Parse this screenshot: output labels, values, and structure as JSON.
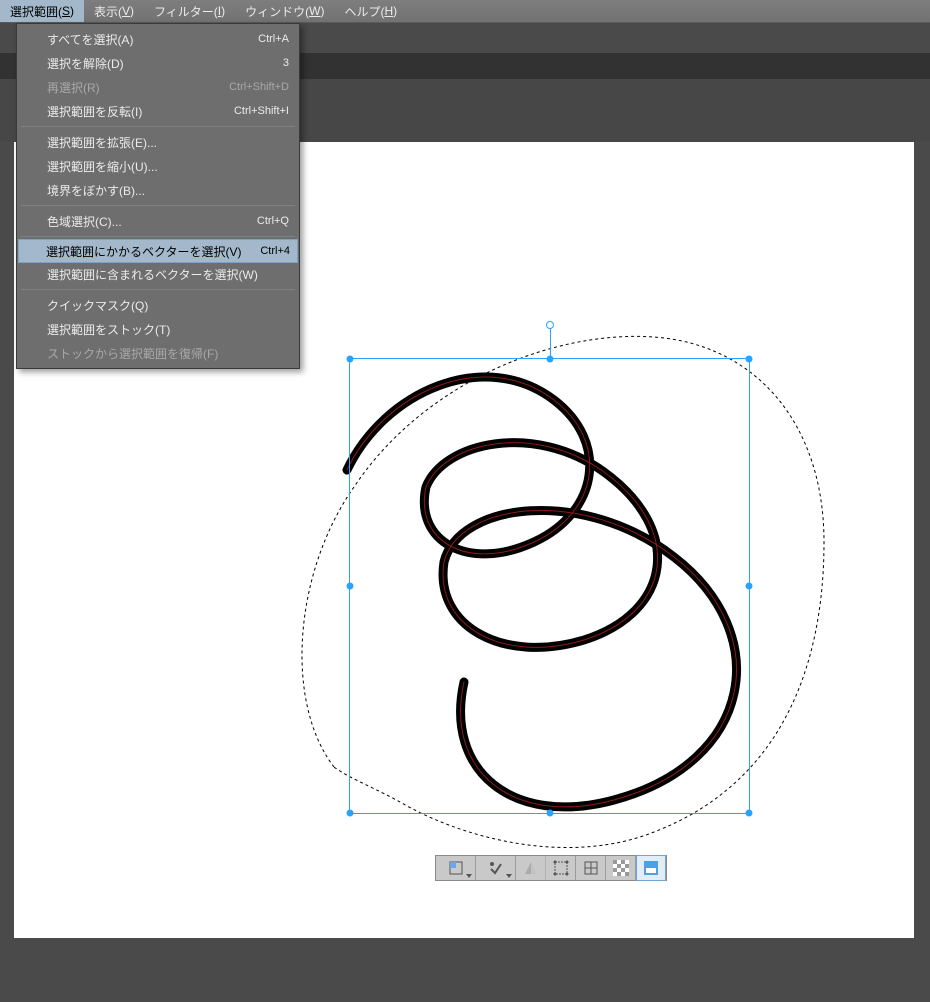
{
  "menubar": [
    {
      "label": "選択範囲",
      "mn": "S",
      "active": true
    },
    {
      "label": "表示",
      "mn": "V"
    },
    {
      "label": "フィルター",
      "mn": "I"
    },
    {
      "label": "ウィンドウ",
      "mn": "W"
    },
    {
      "label": "ヘルプ",
      "mn": "H"
    }
  ],
  "dropdown": {
    "groups": [
      [
        {
          "label": "すべてを選択(A)",
          "shortcut": "Ctrl+A"
        },
        {
          "label": "選択を解除(D)",
          "shortcut": "3"
        },
        {
          "label": "再選択(R)",
          "shortcut": "Ctrl+Shift+D",
          "disabled": true
        },
        {
          "label": "選択範囲を反転(I)",
          "shortcut": "Ctrl+Shift+I"
        }
      ],
      [
        {
          "label": "選択範囲を拡張(E)..."
        },
        {
          "label": "選択範囲を縮小(U)..."
        },
        {
          "label": "境界をぼかす(B)..."
        }
      ],
      [
        {
          "label": "色域選択(C)...",
          "shortcut": "Ctrl+Q"
        }
      ],
      [
        {
          "label": "選択範囲にかかるベクターを選択(V)",
          "shortcut": "Ctrl+4",
          "highlight": true
        },
        {
          "label": "選択範囲に含まれるベクターを選択(W)"
        }
      ],
      [
        {
          "label": "クイックマスク(Q)"
        },
        {
          "label": "選択範囲をストック(T)"
        },
        {
          "label": "ストックから選択範囲を復帰(F)",
          "disabled": true
        }
      ]
    ]
  },
  "float_toolbar": [
    {
      "name": "scale-options",
      "icon": "scale",
      "dropdown": true
    },
    {
      "name": "rotate-tool",
      "icon": "rotate",
      "dropdown": true
    },
    {
      "name": "flip-tool",
      "icon": "flip",
      "disabled": true
    },
    {
      "name": "free-transform",
      "icon": "free"
    },
    {
      "name": "transform-reset",
      "icon": "reset"
    },
    {
      "name": "alpha-checker",
      "icon": "checker"
    },
    {
      "name": "apply",
      "icon": "apply",
      "active": true
    }
  ],
  "colors": {
    "selection_blue": "#2aa2ff",
    "menu_highlight": "#a3b8cb"
  }
}
